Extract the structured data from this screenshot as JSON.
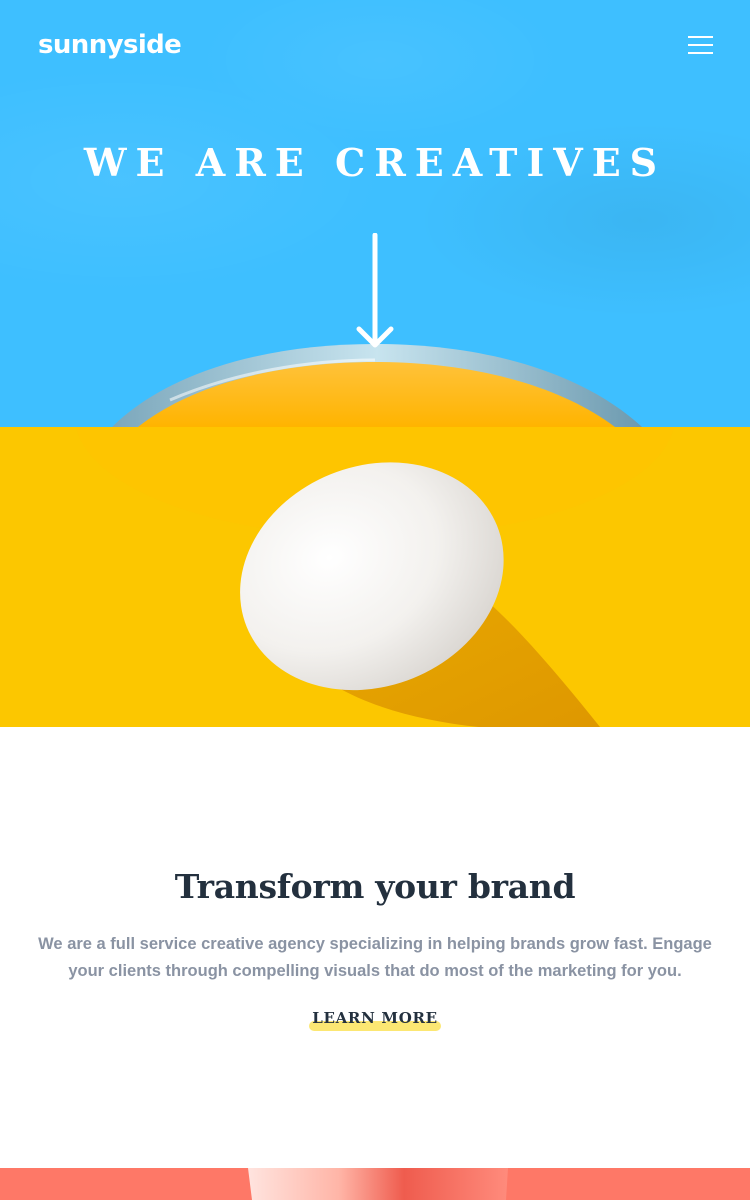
{
  "header": {
    "logo": "sunnyside",
    "menu_icon": "hamburger-menu-icon"
  },
  "hero": {
    "title": "WE ARE CREATIVES",
    "arrow_icon": "arrow-down-icon",
    "background_color": "#3ebfff"
  },
  "egg_image": {
    "description_icon": "egg-photo",
    "background_color": "#fcc700"
  },
  "transform": {
    "title": "Transform your brand",
    "body": "We are a full service creative agency specializing in helping brands grow fast. Engage your clients through compelling visuals that do most of the marketing for you.",
    "cta_label": "LEARN MORE",
    "cta_highlight_color": "#fad400"
  },
  "next_section": {
    "background_color": "#fe7867"
  }
}
